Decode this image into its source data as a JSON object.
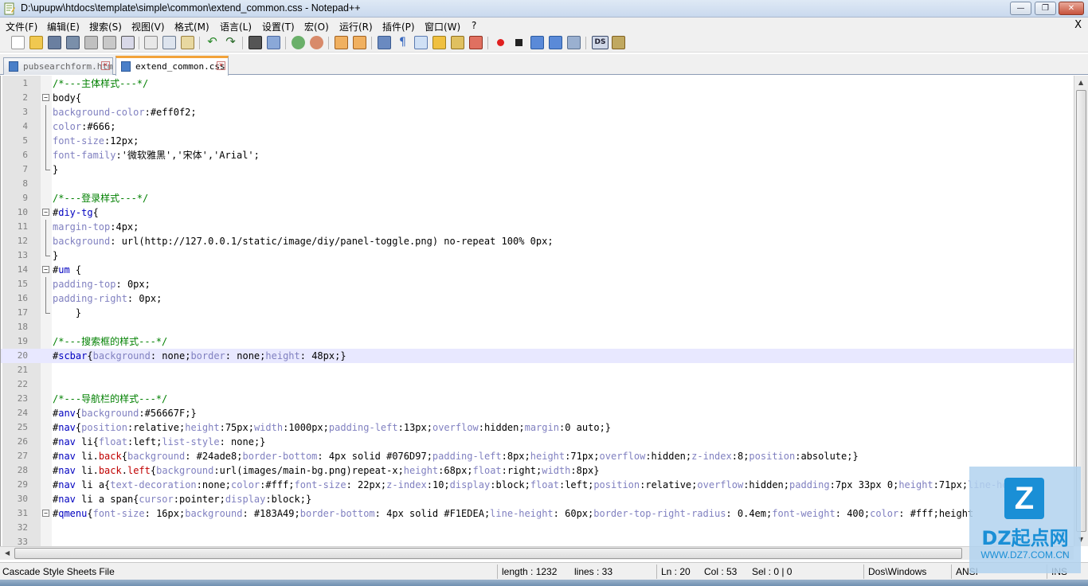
{
  "window": {
    "title": "D:\\upupw\\htdocs\\template\\simple\\common\\extend_common.css - Notepad++",
    "minimize_label": "—",
    "restore_label": "❐",
    "close_label": "✕"
  },
  "menu": {
    "items": [
      "文件(F)",
      "编辑(E)",
      "搜索(S)",
      "视图(V)",
      "格式(M)",
      "语言(L)",
      "设置(T)",
      "宏(O)",
      "运行(R)",
      "插件(P)",
      "窗口(W)",
      "?"
    ],
    "close_label": "X"
  },
  "tabs": [
    {
      "label": "pubsearchform.htm"
    },
    {
      "label": "extend_common.css"
    }
  ],
  "editor": {
    "lines": [
      {
        "n": "1",
        "text": "/*---主体样式---*/"
      },
      {
        "n": "2",
        "text": "body{"
      },
      {
        "n": "3",
        "text": "background-color:#eff0f2;"
      },
      {
        "n": "4",
        "text": "color:#666;"
      },
      {
        "n": "5",
        "text": "font-size:12px;"
      },
      {
        "n": "6",
        "text": "font-family:'微软雅黑','宋体','Arial';"
      },
      {
        "n": "7",
        "text": "}"
      },
      {
        "n": "8",
        "text": ""
      },
      {
        "n": "9",
        "text": "/*---登录样式---*/"
      },
      {
        "n": "10",
        "text": "#diy-tg{"
      },
      {
        "n": "11",
        "text": "margin-top:4px;"
      },
      {
        "n": "12",
        "text": "background: url(http://127.0.0.1/static/image/diy/panel-toggle.png) no-repeat 100% 0px;"
      },
      {
        "n": "13",
        "text": "}"
      },
      {
        "n": "14",
        "text": "#um {"
      },
      {
        "n": "15",
        "text": "padding-top: 0px;"
      },
      {
        "n": "16",
        "text": "padding-right: 0px;"
      },
      {
        "n": "17",
        "text": "    }"
      },
      {
        "n": "18",
        "text": ""
      },
      {
        "n": "19",
        "text": "/*---搜索框的样式---*/"
      },
      {
        "n": "20",
        "text": "#scbar{background: none;border: none;height: 48px;}"
      },
      {
        "n": "21",
        "text": ""
      },
      {
        "n": "22",
        "text": ""
      },
      {
        "n": "23",
        "text": "/*---导航栏的样式---*/"
      },
      {
        "n": "24",
        "text": "#anv{background:#56667F;}"
      },
      {
        "n": "25",
        "text": "#nav{position:relative;height:75px;width:1000px;padding-left:13px;overflow:hidden;margin:0 auto;}"
      },
      {
        "n": "26",
        "text": "#nav li{float:left;list-style: none;}"
      },
      {
        "n": "27",
        "text": "#nav li.back{background: #24ade8;border-bottom: 4px solid #076D97;padding-left:8px;height:71px;overflow:hidden;z-index:8;position:absolute;}"
      },
      {
        "n": "28",
        "text": "#nav li.back.left{background:url(images/main-bg.png)repeat-x;height:68px;float:right;width:8px}"
      },
      {
        "n": "29",
        "text": "#nav li a{text-decoration:none;color:#fff;font-size: 22px;z-index:10;display:block;float:left;position:relative;overflow:hidden;padding:7px 33px 0;height:71px;line-height:"
      },
      {
        "n": "30",
        "text": "#nav li a span{cursor:pointer;display:block;}"
      },
      {
        "n": "31",
        "text": "#qmenu{font-size: 16px;background: #183A49;border-bottom: 4px solid #F1EDEA;line-height: 60px;border-top-right-radius: 0.4em;font-weight: 400;color: #fff;height"
      },
      {
        "n": "32",
        "text": ""
      },
      {
        "n": "33",
        "text": ""
      }
    ]
  },
  "statusbar": {
    "file_type": "Cascade Style Sheets File",
    "length": "length : 1232",
    "lines": "lines : 33",
    "ln": "Ln : 20",
    "col": "Col : 53",
    "sel": "Sel : 0 | 0",
    "eol": "Dos\\Windows",
    "encoding": "ANSI",
    "mode": "INS"
  },
  "watermark": {
    "logo": "Z",
    "name": "DZ起点网",
    "url": "WWW.DZ7.COM.CN"
  },
  "colors": {
    "comment": "#008000",
    "selector": "#000000",
    "property": "#8080c0",
    "current_line": "#e8e8ff",
    "active_tab_accent": "#f2a33a"
  }
}
